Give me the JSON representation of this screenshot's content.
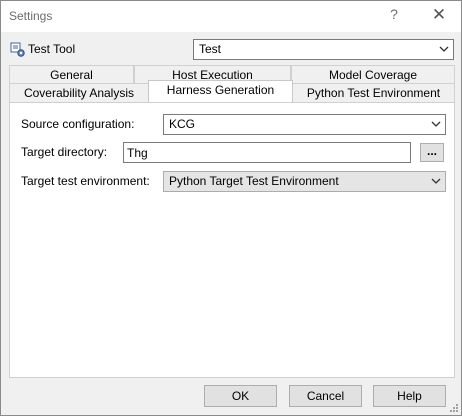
{
  "window": {
    "title": "Settings",
    "help_glyph": "?",
    "close_glyph": "✕"
  },
  "tool": {
    "label": "Test Tool",
    "value": "Test"
  },
  "tabs": {
    "row_top": [
      {
        "label": "General"
      },
      {
        "label": "Host Execution"
      },
      {
        "label": "Model Coverage"
      }
    ],
    "row_bottom": [
      {
        "label": "Coverability Analysis"
      },
      {
        "label": "Harness Generation",
        "active": true
      },
      {
        "label": "Python Test Environment"
      }
    ]
  },
  "form": {
    "source_configuration": {
      "label": "Source configuration:",
      "value": "KCG"
    },
    "target_directory": {
      "label": "Target directory:",
      "value": "Thg",
      "browse_label": "..."
    },
    "target_test_environment": {
      "label": "Target test environment:",
      "value": "Python Target Test Environment"
    }
  },
  "buttons": {
    "ok": "OK",
    "cancel": "Cancel",
    "help": "Help"
  },
  "icons": {
    "tool": "gear-tool-icon",
    "dropdown": "chevron-down-icon",
    "close": "close-icon",
    "grip": "resize-grip-icon"
  }
}
